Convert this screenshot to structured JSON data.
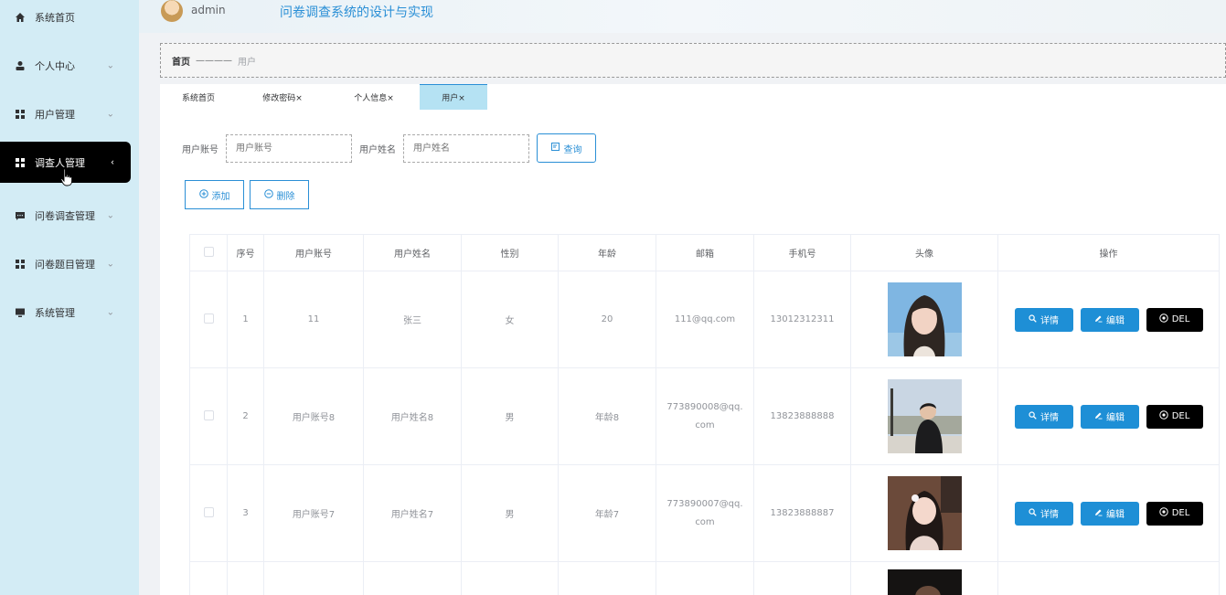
{
  "header": {
    "user": "admin",
    "title": "问卷调查系统的设计与实现"
  },
  "sidebar": {
    "items": [
      {
        "label": "系统首页",
        "icon": "home-icon",
        "chevron": ""
      },
      {
        "label": "个人中心",
        "icon": "person-icon",
        "chevron": "⌄"
      },
      {
        "label": "用户管理",
        "icon": "grid-icon",
        "chevron": "⌄"
      },
      {
        "label": "调查人管理",
        "icon": "grid-icon",
        "chevron": "‹"
      },
      {
        "label": "问卷调查管理",
        "icon": "chat-icon",
        "chevron": "⌄"
      },
      {
        "label": "问卷题目管理",
        "icon": "grid-icon",
        "chevron": "⌄"
      },
      {
        "label": "系统管理",
        "icon": "monitor-icon",
        "chevron": "⌄"
      }
    ]
  },
  "breadcrumb": {
    "home": "首页",
    "sep": "————",
    "current": "用户"
  },
  "tabs": [
    "系统首页",
    "修改密码×",
    "个人信息×",
    "用户×"
  ],
  "search": {
    "account_label": "用户账号",
    "account_placeholder": "用户账号",
    "name_label": "用户姓名",
    "name_placeholder": "用户姓名",
    "query_button": "查询"
  },
  "actions": {
    "add": "添加",
    "delete": "删除"
  },
  "table": {
    "headers": [
      "序号",
      "用户账号",
      "用户姓名",
      "性别",
      "年龄",
      "邮箱",
      "手机号",
      "头像",
      "操作"
    ],
    "rows": [
      {
        "index": "1",
        "account": "11",
        "name": "张三",
        "gender": "女",
        "age": "20",
        "email_a": "111@qq.com",
        "email_b": "",
        "phone": "13012312311"
      },
      {
        "index": "2",
        "account": "用户账号8",
        "name": "用户姓名8",
        "gender": "男",
        "age": "年龄8",
        "email_a": "773890008@qq.",
        "email_b": "com",
        "phone": "13823888888"
      },
      {
        "index": "3",
        "account": "用户账号7",
        "name": "用户姓名7",
        "gender": "男",
        "age": "年龄7",
        "email_a": "773890007@qq.",
        "email_b": "com",
        "phone": "13823888887"
      }
    ],
    "op_detail": "详情",
    "op_edit": "编辑",
    "op_del": "DEL"
  },
  "colors": {
    "accent": "#2a8fd6",
    "sidebar_bg": "#d3ecf5",
    "active_bg": "#000000",
    "op_blue": "#1e8fd6"
  }
}
